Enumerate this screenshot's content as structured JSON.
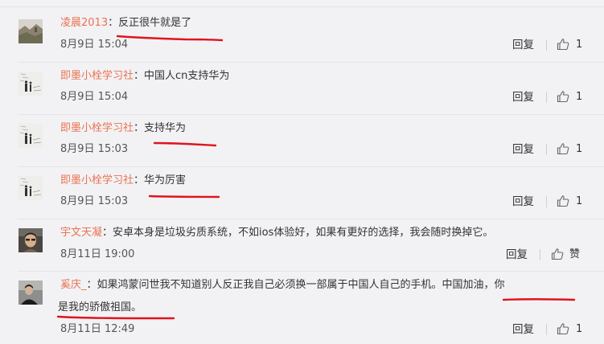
{
  "comments": [
    {
      "user": "凌晨2013",
      "colon": "：",
      "text": "反正很牛就是了",
      "date": "8月9日 15:04",
      "reply": "回复",
      "likes": "1"
    },
    {
      "user": "即墨小栓学习社",
      "colon": "：",
      "text": "中国人cn支持华为",
      "date": "8月9日 15:04",
      "reply": "回复",
      "likes": "1"
    },
    {
      "user": "即墨小栓学习社",
      "colon": "：",
      "text": "支持华为",
      "date": "8月9日 15:03",
      "reply": "回复",
      "likes": "1"
    },
    {
      "user": "即墨小栓学习社",
      "colon": "：",
      "text": "华为厉害",
      "date": "8月9日 15:03",
      "reply": "回复",
      "likes": "1"
    },
    {
      "user": "宇文天凝",
      "colon": "：",
      "text": "安卓本身是垃圾劣质系统，不如ios体验好，如果有更好的选择，我会随时换掉它。",
      "date": "8月11日 19:00",
      "reply": "回复",
      "likes": "赞"
    },
    {
      "user": "奚庆_",
      "colon": "：",
      "text_line1": "如果鸿蒙问世我不知道别人反正我自己必须换一部属于中国人自己的手机。中国加油，你",
      "text_line2": "是我的骄傲祖国。",
      "date": "8月11日 12:49",
      "reply": "回复",
      "likes": "1"
    }
  ],
  "icons": {
    "like": "thumbs-up-icon"
  },
  "colors": {
    "username": "#eb7350",
    "annotation": "#e0141e",
    "background": "#f2f2f5"
  }
}
